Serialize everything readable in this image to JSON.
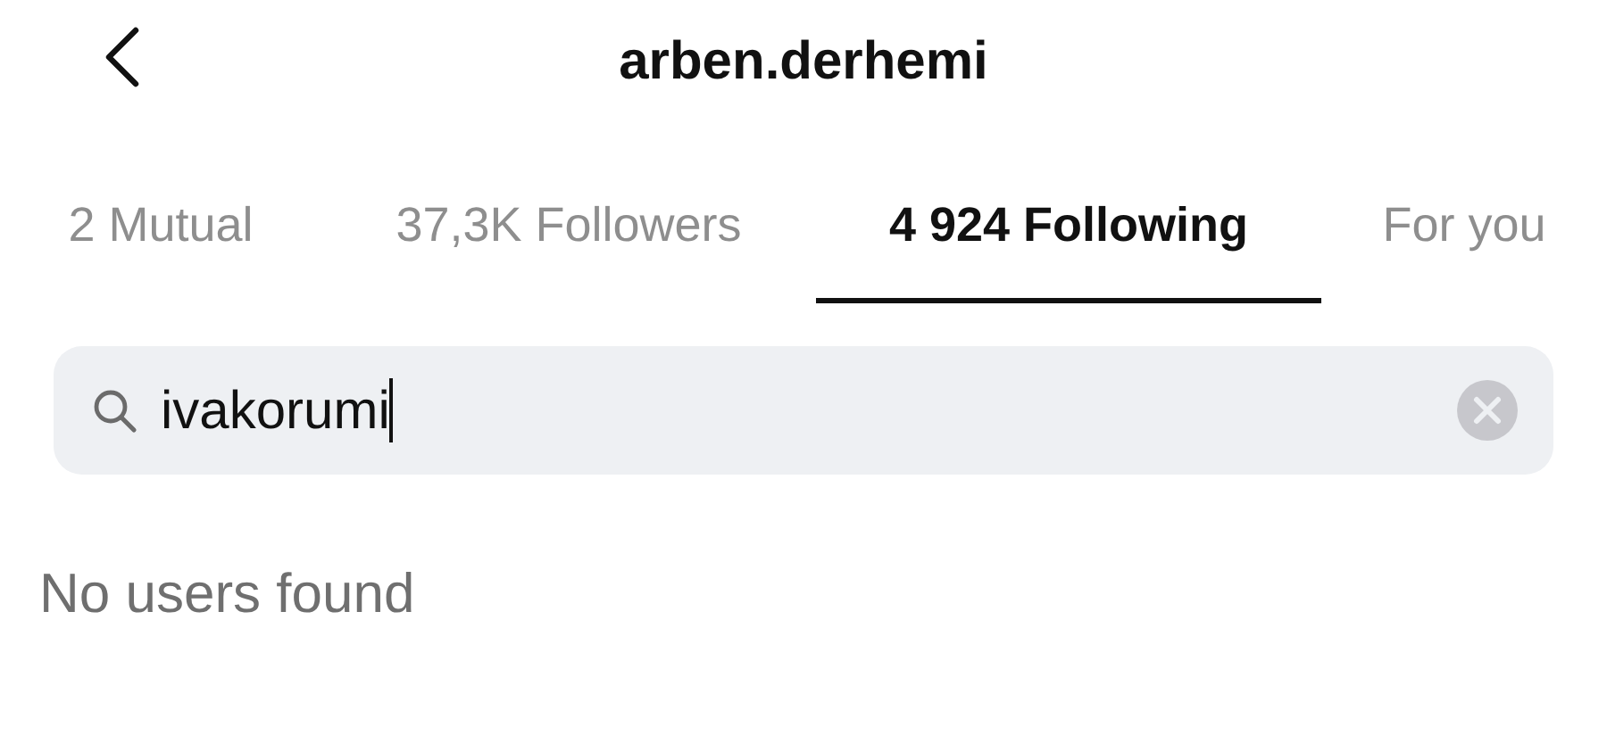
{
  "header": {
    "title": "arben.derhemi"
  },
  "tabs": [
    {
      "label": "2 Mutual",
      "selected": false
    },
    {
      "label": "37,3K Followers",
      "selected": false
    },
    {
      "label": "4 924 Following",
      "selected": true
    },
    {
      "label": "For you",
      "selected": false
    }
  ],
  "search": {
    "value": "ivakorumi",
    "focused": true
  },
  "empty_message": "No users found"
}
